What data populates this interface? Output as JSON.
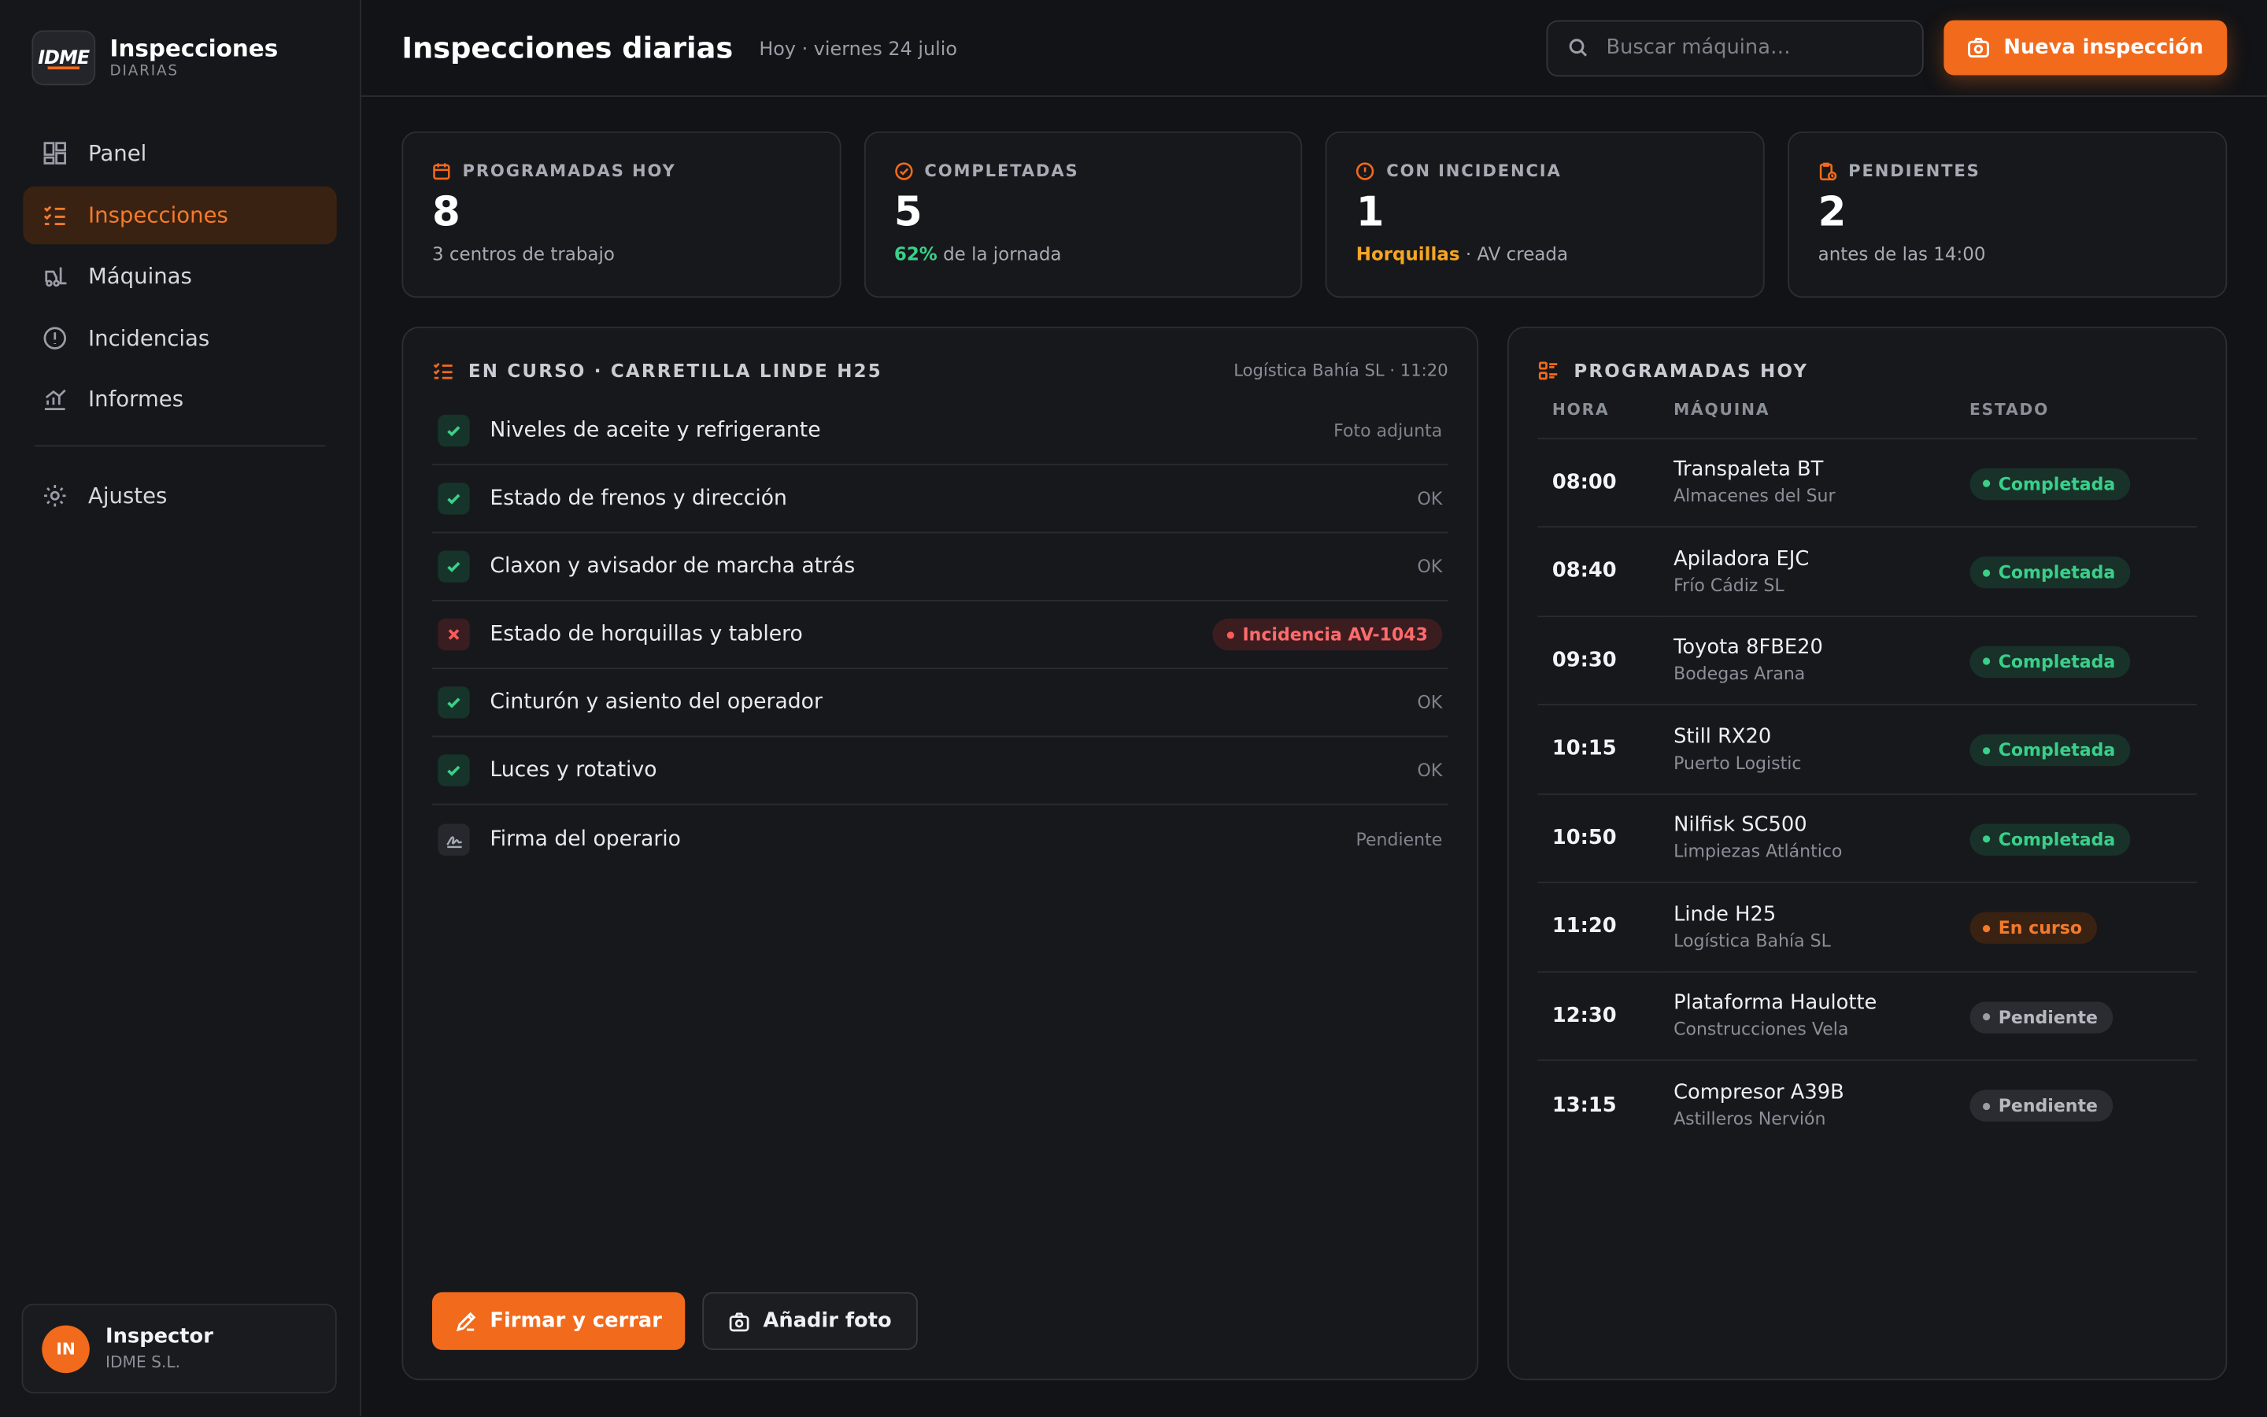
{
  "brand": {
    "logo_text": "IDME",
    "title": "Inspecciones",
    "subtitle": "DIARIAS"
  },
  "nav": [
    {
      "label": "Panel",
      "icon": "dashboard-icon",
      "active": false
    },
    {
      "label": "Inspecciones",
      "icon": "checklist-icon",
      "active": true
    },
    {
      "label": "Máquinas",
      "icon": "forklift-icon",
      "active": false
    },
    {
      "label": "Incidencias",
      "icon": "alert-icon",
      "active": false
    },
    {
      "label": "Informes",
      "icon": "chart-icon",
      "active": false
    },
    {
      "label": "Ajustes",
      "icon": "gear-icon",
      "active": false
    }
  ],
  "user": {
    "initials": "IN",
    "name": "Inspector",
    "org": "IDME S.L."
  },
  "header": {
    "title": "Inspecciones diarias",
    "date": "Hoy · viernes 24 julio",
    "search_placeholder": "Buscar máquina…",
    "new_button": "Nueva inspección"
  },
  "stats": [
    {
      "label": "PROGRAMADAS HOY",
      "value": "8",
      "note_strong": "",
      "note": "3 centros de trabajo",
      "icon": "calendar-icon"
    },
    {
      "label": "COMPLETADAS",
      "value": "5",
      "note_strong": "62%",
      "note": " de la jornada",
      "icon": "check-circle-icon"
    },
    {
      "label": "CON INCIDENCIA",
      "value": "1",
      "note_strong": "Horquillas",
      "note": " · AV creada",
      "icon": "alert-icon"
    },
    {
      "label": "PENDIENTES",
      "value": "2",
      "note_strong": "",
      "note": "antes de las 14:00",
      "icon": "clipboard-clock-icon"
    }
  ],
  "current": {
    "title": "EN CURSO · CARRETILLA LINDE H25",
    "meta": "Logística Bahía SL · 11:20",
    "items": [
      {
        "label": "Niveles de aceite y refrigerante",
        "status": "Foto adjunta",
        "state": "ok"
      },
      {
        "label": "Estado de frenos y dirección",
        "status": "OK",
        "state": "ok"
      },
      {
        "label": "Claxon y avisador de marcha atrás",
        "status": "OK",
        "state": "ok"
      },
      {
        "label": "Estado de horquillas y tablero",
        "status": "Incidencia AV-1043",
        "state": "bad"
      },
      {
        "label": "Cinturón y asiento del operador",
        "status": "OK",
        "state": "ok"
      },
      {
        "label": "Luces y rotativo",
        "status": "OK",
        "state": "ok"
      },
      {
        "label": "Firma del operario",
        "status": "Pendiente",
        "state": "pending"
      }
    ],
    "sign_button": "Firmar y cerrar",
    "photo_button": "Añadir foto"
  },
  "schedule": {
    "title": "PROGRAMADAS HOY",
    "columns": [
      "HORA",
      "MÁQUINA",
      "ESTADO"
    ],
    "rows": [
      {
        "hour": "08:00",
        "machine": "Transpaleta BT",
        "client": "Almacenes del Sur",
        "status": "Completada",
        "kind": "done"
      },
      {
        "hour": "08:40",
        "machine": "Apiladora EJC",
        "client": "Frío Cádiz SL",
        "status": "Completada",
        "kind": "done"
      },
      {
        "hour": "09:30",
        "machine": "Toyota 8FBE20",
        "client": "Bodegas Arana",
        "status": "Completada",
        "kind": "done"
      },
      {
        "hour": "10:15",
        "machine": "Still RX20",
        "client": "Puerto Logistic",
        "status": "Completada",
        "kind": "done"
      },
      {
        "hour": "10:50",
        "machine": "Nilfisk SC500",
        "client": "Limpiezas Atlántico",
        "status": "Completada",
        "kind": "done"
      },
      {
        "hour": "11:20",
        "machine": "Linde H25",
        "client": "Logística Bahía SL",
        "status": "En curso",
        "kind": "run"
      },
      {
        "hour": "12:30",
        "machine": "Plataforma Haulotte",
        "client": "Construcciones Vela",
        "status": "Pendiente",
        "kind": "pend"
      },
      {
        "hour": "13:15",
        "machine": "Compresor A39B",
        "client": "Astilleros Nervión",
        "status": "Pendiente",
        "kind": "pend"
      }
    ]
  },
  "colors": {
    "accent": "#f26a1b",
    "success": "#3ad08a",
    "danger": "#ff6b6b",
    "warning": "#f5a623"
  }
}
